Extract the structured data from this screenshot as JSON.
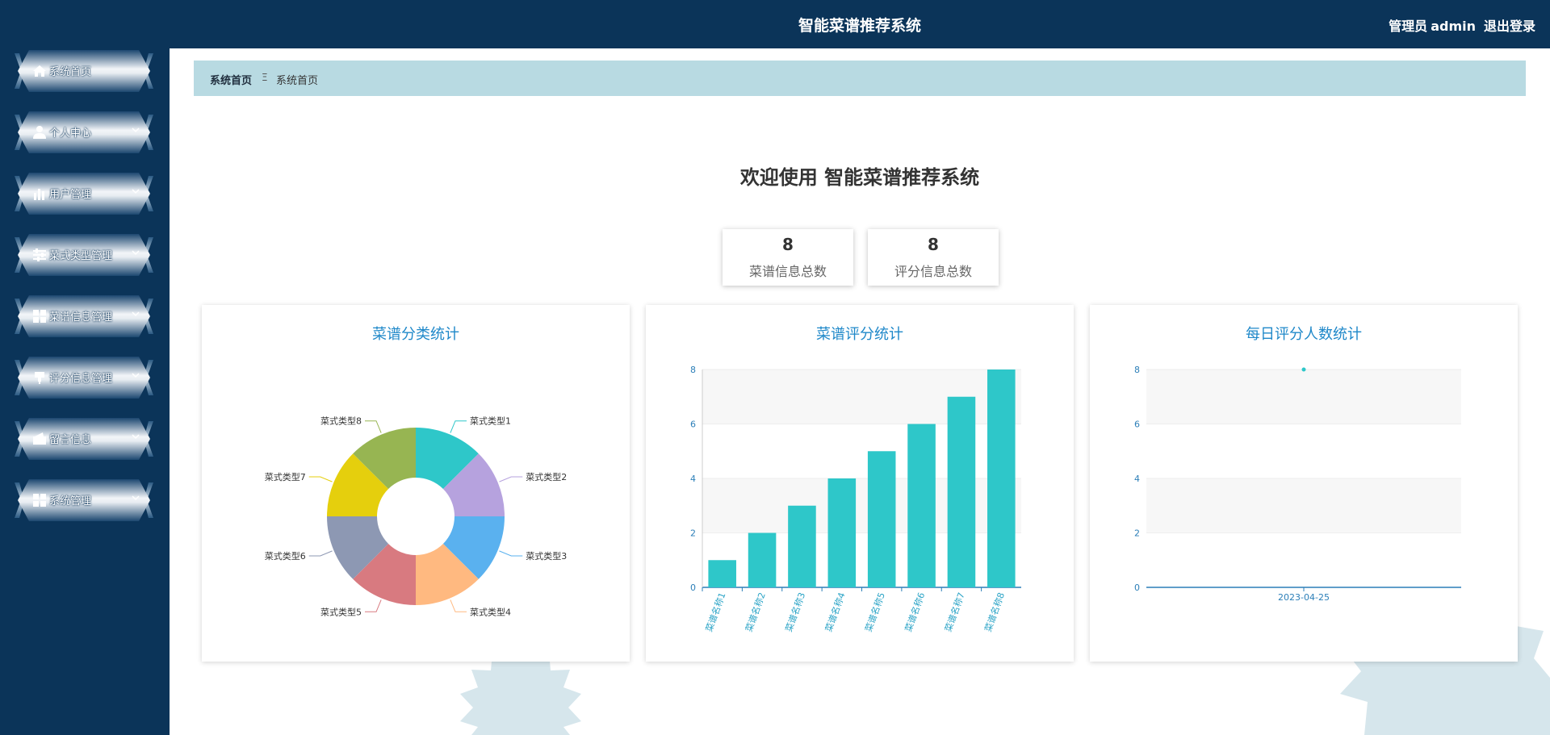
{
  "header": {
    "title": "智能菜谱推荐系统",
    "role": "管理员",
    "user": "admin",
    "logout": "退出登录"
  },
  "sidebar": {
    "items": [
      {
        "label": "系统首页",
        "icon": "home-icon",
        "has_chevron": false
      },
      {
        "label": "个人中心",
        "icon": "user-icon",
        "has_chevron": true
      },
      {
        "label": "用户管理",
        "icon": "bar-chart-icon",
        "has_chevron": true
      },
      {
        "label": "菜式类型管理",
        "icon": "sliders-icon",
        "has_chevron": true
      },
      {
        "label": "菜谱信息管理",
        "icon": "grid-icon",
        "has_chevron": true
      },
      {
        "label": "评分信息管理",
        "icon": "pin-icon",
        "has_chevron": true
      },
      {
        "label": "留言信息",
        "icon": "wallet-icon",
        "has_chevron": true
      },
      {
        "label": "系统管理",
        "icon": "grid-icon",
        "has_chevron": true
      }
    ]
  },
  "breadcrumb": {
    "home": "系统首页",
    "separator": "Ξ",
    "current": "系统首页"
  },
  "welcome": "欢迎使用 智能菜谱推荐系统",
  "stats": [
    {
      "value": "8",
      "label": "菜谱信息总数"
    },
    {
      "value": "8",
      "label": "评分信息总数"
    }
  ],
  "colors": {
    "navy": "#0b3459",
    "breadcrumb_bg": "#b8dae2",
    "title_blue": "#1f88c9",
    "bar": "#2ec7c9"
  },
  "chart_data": [
    {
      "type": "pie",
      "title": "菜谱分类统计",
      "categories": [
        "菜式类型1",
        "菜式类型2",
        "菜式类型3",
        "菜式类型4",
        "菜式类型5",
        "菜式类型6",
        "菜式类型7",
        "菜式类型8"
      ],
      "values": [
        1,
        1,
        1,
        1,
        1,
        1,
        1,
        1
      ],
      "colors": [
        "#2ec7c9",
        "#b6a2de",
        "#5ab1ef",
        "#ffb980",
        "#d87a80",
        "#8d98b3",
        "#e5cf0d",
        "#97b552"
      ]
    },
    {
      "type": "bar",
      "title": "菜谱评分统计",
      "categories": [
        "菜谱名称1",
        "菜谱名称2",
        "菜谱名称3",
        "菜谱名称4",
        "菜谱名称5",
        "菜谱名称6",
        "菜谱名称7",
        "菜谱名称8"
      ],
      "values": [
        1,
        2,
        3,
        4,
        5,
        6,
        7,
        8
      ],
      "ylim": [
        0,
        8
      ],
      "yticks": [
        0,
        2,
        4,
        6,
        8
      ]
    },
    {
      "type": "line",
      "title": "每日评分人数统计",
      "categories": [
        "2023-04-25"
      ],
      "values": [
        8
      ],
      "ylim": [
        0,
        8
      ],
      "yticks": [
        0,
        2,
        4,
        6,
        8
      ]
    }
  ]
}
